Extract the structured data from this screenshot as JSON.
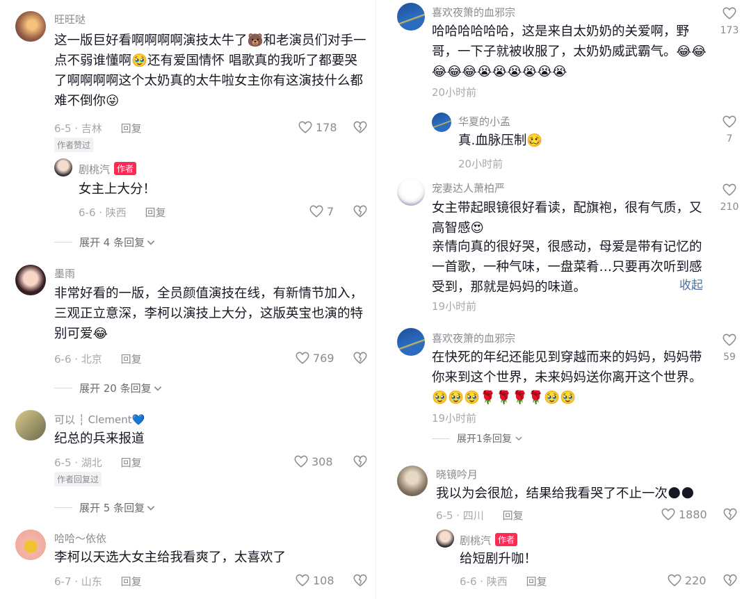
{
  "left": {
    "c1": {
      "name": "旺旺哒",
      "text": "这一版巨好看啊啊啊啊演技太牛了🐻和老演员们对手一点不弱谁懂啊🥹还有爱国情怀 唱歌真的我听了都要哭了啊啊啊啊这个太奶真的太牛啦女主你有这演技什么都难不倒你😜",
      "date": "6-5 · 吉林",
      "reply": "回复",
      "likes": "178",
      "tag": "作者赞过",
      "sub": {
        "name": "剧桃汽",
        "author_tag": "作者",
        "text": "女主上大分！",
        "date": "6-6 · 陕西",
        "reply": "回复",
        "likes": "7"
      },
      "expand": "展开 4 条回复"
    },
    "c2": {
      "name": "墨雨",
      "text": "非常好看的一版，全员颜值演技在线，有新情节加入，三观正立意深，李柯以演技上大分，这版英宝也演的特别可爱😂",
      "date": "6-6 · 北京",
      "reply": "回复",
      "likes": "769",
      "expand": "展开 20 条回复"
    },
    "c3": {
      "name": "可以 ┆ Clement💙",
      "text": "纪总的兵来报道",
      "date": "6-5 · 湖北",
      "reply": "回复",
      "likes": "308",
      "tag": "作者回复过",
      "expand": "展开 5 条回复"
    },
    "c4": {
      "name": "哈哈～依依",
      "text": "李柯以天选大女主给我看爽了，太喜欢了",
      "date": "6-7 · 山东",
      "reply": "回复",
      "likes": "108"
    }
  },
  "right": {
    "c1": {
      "name": "喜欢夜箫的血邪宗",
      "text": "哈哈哈哈哈哈，这是来自太奶奶的关爱啊，野哥，一下子就被收服了，太奶奶威武霸气。😂😂😂😂😂😭😭😭😭😭😭",
      "time": "20小时前",
      "likes": "173",
      "sub": {
        "name": "华夏的小孟",
        "text": "真.血脉压制🥴",
        "time": "20小时前",
        "likes": "7"
      }
    },
    "c2": {
      "name": "宠妻达人萧柏严",
      "text1": "女主带起眼镜很好看读，配旗袍，很有气质，又高智感😍",
      "text2": "亲情向真的很好哭，很感动，母爱是带有记忆的一首歌，一种气味，一盘菜肴…只要再次听到感受到，那就是妈妈的味道。",
      "collapse": "收起",
      "time": "19小时前",
      "likes": "210"
    },
    "c3": {
      "name": "喜欢夜箫的血邪宗",
      "text": "在快死的年纪还能见到穿越而来的妈妈，妈妈带你来到这个世界，未来妈妈送你离开这个世界。🥹🥹🥹🌹🌹🌹🌹🥹🥹",
      "time": "19小时前",
      "likes": "59",
      "expand": "展开1条回复"
    },
    "c4": {
      "name": "晓镜吟月",
      "text": "我以为会很尬，结果给我看哭了不止一次🌑🌑",
      "date": "6-5 · 四川",
      "reply": "回复",
      "likes": "1880",
      "sub": {
        "name": "剧桃汽",
        "author_tag": "作者",
        "text": "给短剧升咖！",
        "date": "6-6 · 陕西",
        "reply": "回复",
        "likes": "220"
      }
    }
  },
  "icons": {
    "like": "heart-outline-icon",
    "dislike": "broken-heart-icon",
    "chevron": "chevron-down-icon"
  },
  "colors": {
    "author_tag_bg": "#fe2c55",
    "collapse_link": "#4a6fa5"
  }
}
